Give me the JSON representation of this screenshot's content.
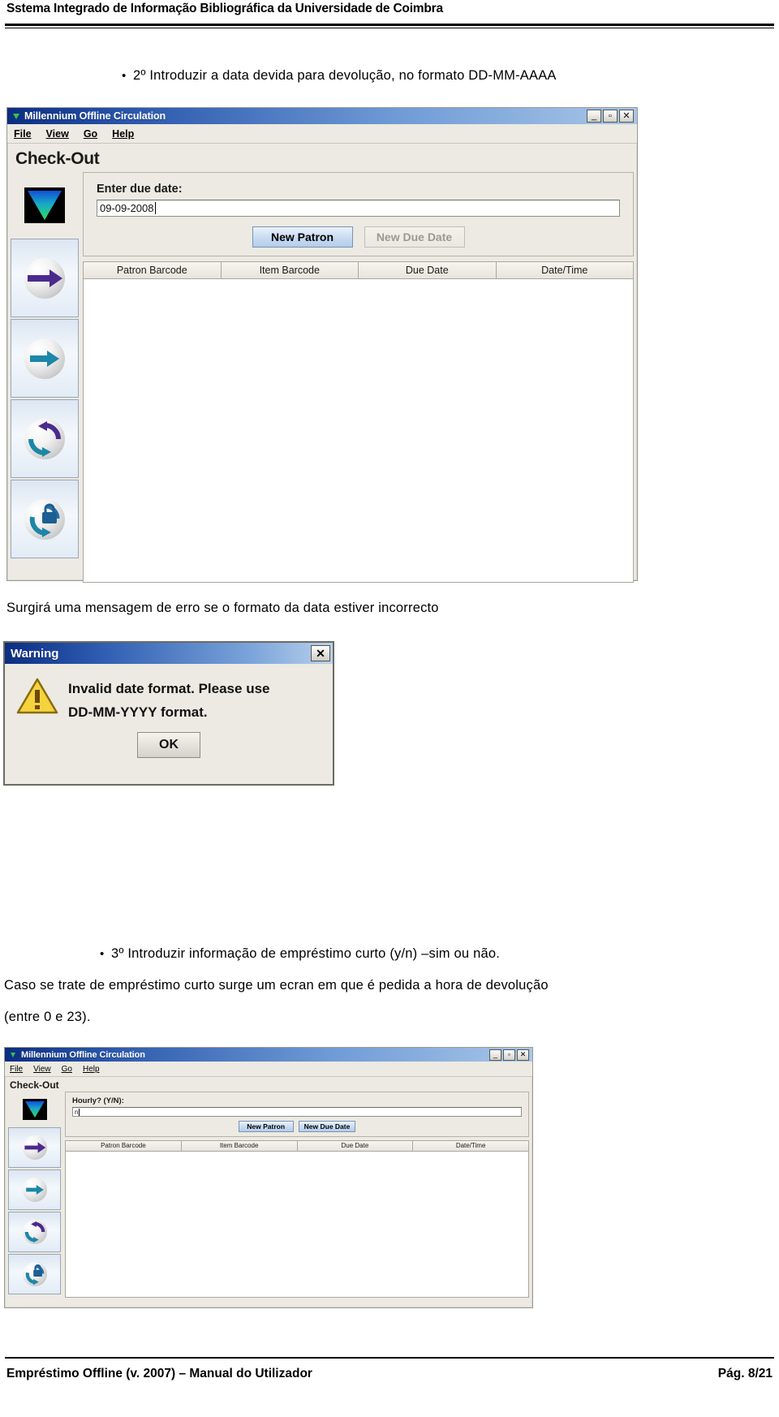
{
  "header": {
    "title": "Sstema Integrado de Informação Bibliográfica da Universidade de Coimbra"
  },
  "steps": {
    "step2_bullet": "•",
    "step2_text": "2º Introduzir a data devida para devolução, no formato DD-MM-AAAA",
    "step3_bullet": "•",
    "step3_text": "3º Introduzir informação de empréstimo curto (y/n) –sim ou não."
  },
  "paragraphs": {
    "error_note": "Surgirá uma mensagem de erro se o formato da data estiver incorrecto",
    "short_loan_line1": "Caso se trate de empréstimo curto surge um ecran em que é pedida a hora de devolução",
    "short_loan_line2": "(entre 0 e 23)."
  },
  "window1": {
    "title": "Millennium Offline Circulation",
    "app_icon": "millennium-triangle-icon",
    "controls": [
      {
        "name": "minimize",
        "glyph": "_"
      },
      {
        "name": "maximize",
        "glyph": "▫"
      },
      {
        "name": "close",
        "glyph": "✕"
      }
    ],
    "menus": [
      {
        "label": "File",
        "accel": "F"
      },
      {
        "label": "View",
        "accel": "V"
      },
      {
        "label": "Go",
        "accel": "G"
      },
      {
        "label": "Help",
        "accel": "H"
      }
    ],
    "heading": "Check-Out",
    "sidebar": [
      {
        "icon": "download-triangle-icon",
        "name": "sidebar-download"
      },
      {
        "icon": "purple-arrow-right-icon",
        "name": "sidebar-check-out"
      },
      {
        "icon": "teal-arrow-right-icon",
        "name": "sidebar-check-in"
      },
      {
        "icon": "circular-refresh-icon",
        "name": "sidebar-renew"
      },
      {
        "icon": "padlock-refresh-icon",
        "name": "sidebar-secure-renew"
      }
    ],
    "form": {
      "label": "Enter due date:",
      "input_value": "09-09-2008"
    },
    "buttons": {
      "new_patron": "New Patron",
      "new_patron_accel": "P",
      "new_due_date": "New Due Date",
      "new_due_date_accel": "D"
    },
    "table_headers": [
      "Patron Barcode",
      "Item Barcode",
      "Due Date",
      "Date/Time"
    ]
  },
  "warning": {
    "title": "Warning",
    "close_glyph": "✕",
    "icon": "warning-triangle-icon",
    "message_line1": "Invalid date format.  Please use",
    "message_line2": "DD-MM-YYYY format.",
    "ok_label": "OK"
  },
  "window2": {
    "title": "Millennium Offline Circulation",
    "app_icon": "millennium-triangle-icon",
    "controls": [
      {
        "name": "minimize",
        "glyph": "_"
      },
      {
        "name": "maximize",
        "glyph": "▫"
      },
      {
        "name": "close",
        "glyph": "✕"
      }
    ],
    "menus": [
      {
        "label": "File",
        "accel": "F"
      },
      {
        "label": "View",
        "accel": "V"
      },
      {
        "label": "Go",
        "accel": "G"
      },
      {
        "label": "Help",
        "accel": "H"
      }
    ],
    "heading": "Check-Out",
    "sidebar": [
      {
        "icon": "download-triangle-icon",
        "name": "sidebar-download"
      },
      {
        "icon": "purple-arrow-right-icon",
        "name": "sidebar-check-out"
      },
      {
        "icon": "teal-arrow-right-icon",
        "name": "sidebar-check-in"
      },
      {
        "icon": "circular-refresh-icon",
        "name": "sidebar-renew"
      },
      {
        "icon": "padlock-refresh-icon",
        "name": "sidebar-secure-renew"
      }
    ],
    "form": {
      "label": "Hourly? (Y/N):",
      "input_value": "n"
    },
    "buttons": {
      "new_patron": "New Patron",
      "new_patron_accel": "P",
      "new_due_date": "New Due Date",
      "new_due_date_accel": "D"
    },
    "table_headers": [
      "Patron Barcode",
      "Item Barcode",
      "Due Date",
      "Date/Time"
    ]
  },
  "footer": {
    "left": "Empréstimo Offline (v. 2007) – Manual do Utilizador",
    "right": "Pág. 8/21"
  },
  "colors": {
    "titlebar_start": "#0b2d82",
    "titlebar_end": "#a8c6e8",
    "window_face": "#eceae2",
    "button_blue": "#cfe0f3",
    "warning_yellow": "#f5d33f",
    "arrow_purple": "#4b2a8f",
    "arrow_teal": "#1c87a8"
  }
}
